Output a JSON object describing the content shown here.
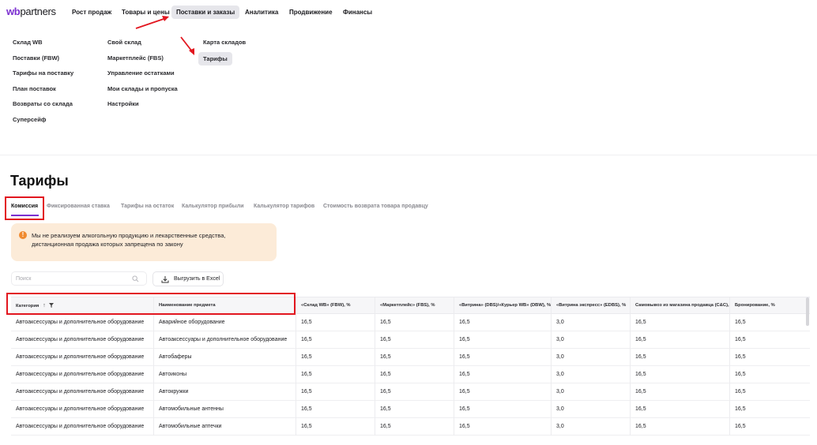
{
  "brand": {
    "logo_wb": "wb",
    "logo_partners": "partners"
  },
  "topnav": [
    {
      "label": "Рост продаж",
      "active": false
    },
    {
      "label": "Товары и цены",
      "active": false
    },
    {
      "label": "Поставки и заказы",
      "active": true
    },
    {
      "label": "Аналитика",
      "active": false
    },
    {
      "label": "Продвижение",
      "active": false
    },
    {
      "label": "Финансы",
      "active": false
    }
  ],
  "menu": {
    "col1": [
      "Склад WB",
      "Поставки (FBW)",
      "Тарифы на поставку",
      "План поставок",
      "Возвраты со склада",
      "Суперсейф"
    ],
    "col2": [
      "Свой склад",
      "Маркетплейс (FBS)",
      "Управление остатками",
      "Мои склады и пропуска",
      "Настройки"
    ],
    "col3": [
      "Карта складов",
      "Тарифы"
    ],
    "col3_active": "Тарифы"
  },
  "page": {
    "title": "Тарифы"
  },
  "tabs": [
    {
      "label": "Комиссия",
      "active": true
    },
    {
      "label": "Фиксированная ставка",
      "active": false
    },
    {
      "label": "Тарифы на остаток",
      "active": false
    },
    {
      "label": "Калькулятор прибыли",
      "active": false
    },
    {
      "label": "Калькулятор тарифов",
      "active": false
    },
    {
      "label": "Стоимость возврата товара продавцу",
      "active": false
    }
  ],
  "alert": {
    "icon": "!",
    "text": "Мы не реализуем алкогольную продукцию и лекарственные средства, дистанционная продажа которых запрещена по закону"
  },
  "search": {
    "placeholder": "Поиск",
    "value": ""
  },
  "export": {
    "label": "Выгрузить в Excel"
  },
  "table": {
    "columns": [
      "Категория",
      "Наименование предмета",
      "«Склад WB» (FBW), %",
      "«Маркетплейс» (FBS), %",
      "«Витрина» (DBS)/«Курьер WB» (DBW), %",
      "«Витрина экспресс» (EDBS), %",
      "Самовывоз из магазина продавца (C&C), %",
      "Бронирование, %"
    ],
    "sort_icon": "↑",
    "rows": [
      [
        "Автоаксессуары и дополнительное оборудование",
        "Аварийное оборудование",
        "16,5",
        "16,5",
        "16,5",
        "3,0",
        "16,5",
        "16,5"
      ],
      [
        "Автоаксессуары и дополнительное оборудование",
        "Автоаксессуары и дополнительное оборудование",
        "16,5",
        "16,5",
        "16,5",
        "3,0",
        "16,5",
        "16,5"
      ],
      [
        "Автоаксессуары и дополнительное оборудование",
        "Автобаферы",
        "16,5",
        "16,5",
        "16,5",
        "3,0",
        "16,5",
        "16,5"
      ],
      [
        "Автоаксессуары и дополнительное оборудование",
        "Автоиконы",
        "16,5",
        "16,5",
        "16,5",
        "3,0",
        "16,5",
        "16,5"
      ],
      [
        "Автоаксессуары и дополнительное оборудование",
        "Автокружки",
        "16,5",
        "16,5",
        "16,5",
        "3,0",
        "16,5",
        "16,5"
      ],
      [
        "Автоаксессуары и дополнительное оборудование",
        "Автомобильные антенны",
        "16,5",
        "16,5",
        "16,5",
        "3,0",
        "16,5",
        "16,5"
      ],
      [
        "Автоаксессуары и дополнительное оборудование",
        "Автомобильные аптечки",
        "16,5",
        "16,5",
        "16,5",
        "3,0",
        "16,5",
        "16,5"
      ]
    ]
  },
  "colors": {
    "accent": "#7b2fd0",
    "annotation_red": "#e2161f",
    "alert_bg": "#fcebd8",
    "alert_icon": "#f08a2f"
  }
}
